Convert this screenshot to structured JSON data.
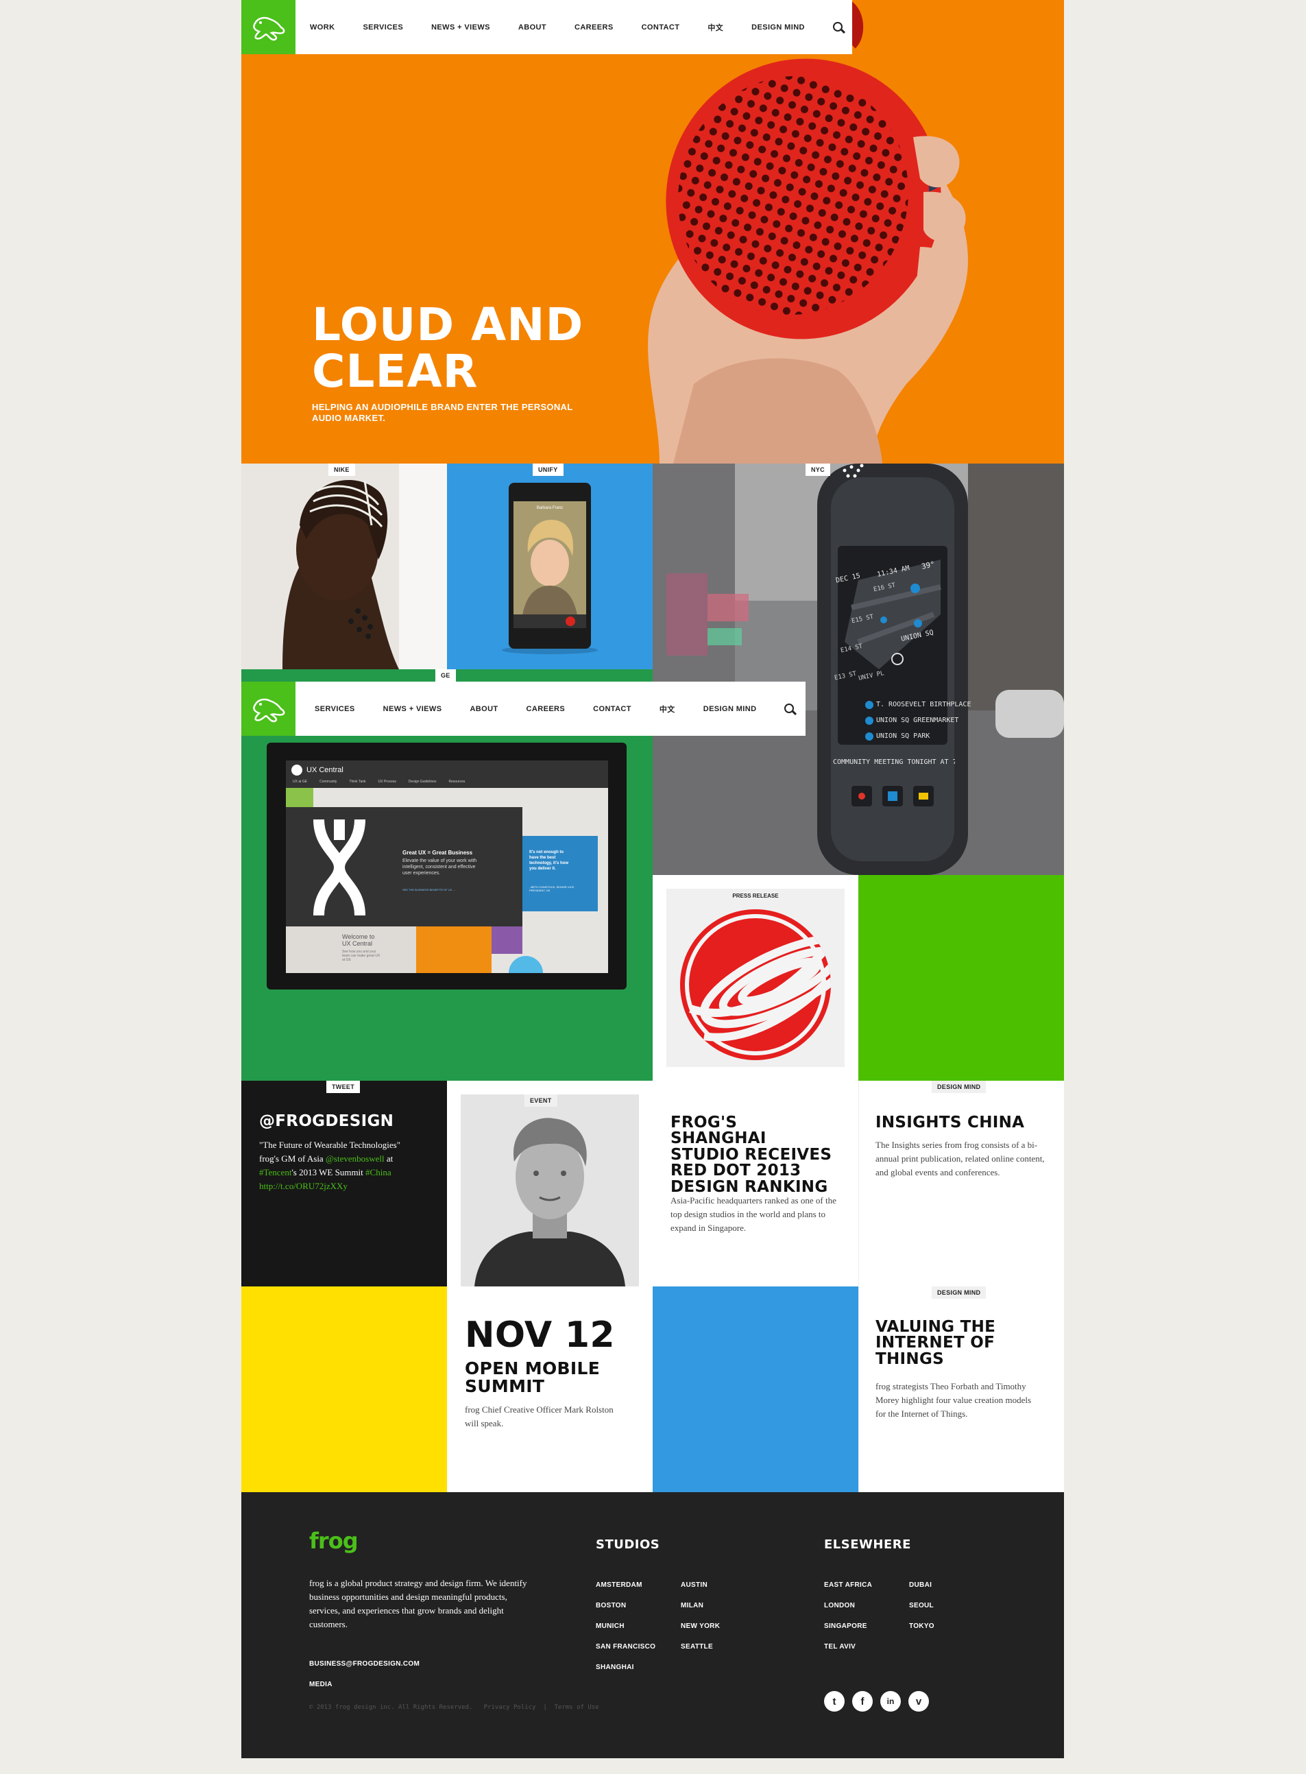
{
  "nav": {
    "items": [
      "WORK",
      "SERVICES",
      "NEWS + VIEWS",
      "ABOUT",
      "CAREERS",
      "CONTACT",
      "中文",
      "DESIGN MIND"
    ],
    "search_icon": "search-icon"
  },
  "nav2": {
    "items": [
      "SERVICES",
      "NEWS + VIEWS",
      "ABOUT",
      "CAREERS",
      "CONTACT",
      "中文",
      "DESIGN MIND"
    ]
  },
  "hero": {
    "title_line1": "LOUD AND",
    "title_line2": "CLEAR",
    "subtitle_line1": "HELPING AN AUDIOPHILE BRAND ENTER THE PERSONAL",
    "subtitle_line2": "AUDIO MARKET."
  },
  "tags": {
    "nike": "NIKE",
    "unify": "UNIFY",
    "nyc": "NYC",
    "ge": "GE",
    "press": "PRESS RELEASE",
    "tweet": "TWEET",
    "event": "EVENT",
    "designmind1": "DESIGN MIND",
    "designmind2": "DESIGN MIND"
  },
  "unify_phone": {
    "caller": "Barbara Franz"
  },
  "nyc_kiosk": {
    "date": "DEC 15",
    "time": "11:34 AM",
    "temp": "39°",
    "streets": [
      "E16 ST",
      "E15 ST",
      "E14 ST",
      "E13 ST",
      "UNION SQ",
      "UNIV PL"
    ],
    "pois": [
      "T. ROOSEVELT BIRTHPLACE",
      "UNION SQ GREENMARKET",
      "UNION SQ PARK"
    ],
    "ticker": "COMMUNITY MEETING TONIGHT AT 7:"
  },
  "ge_screen": {
    "app_title": "UX Central",
    "menu": [
      "UX at GE",
      "Community",
      "Think Tank",
      "UX Process",
      "Design Guidelines",
      "Resources"
    ],
    "headline": "Great UX = Great Business",
    "body": "Elevate the value of your work with intelligent, consistent and effective user experiences.",
    "link": "SEE THE BUSINESS BENEFITS OF UX →",
    "quote": "It's not enough to have the best technology, it's how you deliver it.",
    "quote_by": "- BETH COMSTOCK, SENIOR VICE PRESIDENT, GE",
    "welcome": "Welcome to UX Central",
    "welcome_body": "See how you and your team can make great UX at GE"
  },
  "tweet": {
    "handle": "@FROGDESIGN",
    "line1": "\"The Future of Wearable Technologies\"",
    "line2_a": "frog's GM of Asia ",
    "line2_mention": "@stevenboswell",
    "line2_b": " at",
    "line3_hashtag1": "#Tencent",
    "line3_b": "'s 2013 WE Summit ",
    "line3_hashtag2": "#China",
    "line4_link": "http://t.co/ORU72jzXXy"
  },
  "news_shanghai": {
    "title": "FROG'S SHANGHAI STUDIO RECEIVES RED DOT 2013 DESIGN RANKING",
    "body": "Asia-Pacific headquarters ranked as one of the top design studios in the world and plans to expand in Singapore."
  },
  "insights": {
    "title": "INSIGHTS CHINA",
    "body": "The Insights series from frog consists of a bi-annual print publication, related online content, and global events and conferences."
  },
  "event": {
    "date": "NOV 12",
    "title": "OPEN MOBILE SUMMIT",
    "body": "frog Chief Creative Officer Mark Rolston will speak."
  },
  "iot": {
    "title": "VALUING THE INTERNET OF THINGS",
    "body": "frog strategists Theo Forbath and Timothy Morey highlight four value creation models for the Internet of Things."
  },
  "footer": {
    "logo": "frog",
    "about": "frog is a global product strategy and design firm. We identify business opportunities and design meaningful products, services, and experiences that grow brands and delight customers.",
    "email": "BUSINESS@FROGDESIGN.COM",
    "media": "MEDIA",
    "copyright": "© 2013 frog design inc. All Rights Reserved.   Privacy Policy  |  Terms of Use",
    "studios_title": "STUDIOS",
    "studios_col1": [
      "AMSTERDAM",
      "BOSTON",
      "MUNICH",
      "SAN FRANCISCO",
      "SHANGHAI"
    ],
    "studios_col2": [
      "AUSTIN",
      "MILAN",
      "NEW YORK",
      "SEATTLE"
    ],
    "elsewhere_title": "ELSEWHERE",
    "elsewhere_col1": [
      "EAST AFRICA",
      "LONDON",
      "SINGAPORE",
      "TEL AVIV"
    ],
    "elsewhere_col2": [
      "DUBAI",
      "SEOUL",
      "TOKYO"
    ],
    "social": [
      {
        "name": "twitter-icon",
        "glyph": "t"
      },
      {
        "name": "facebook-icon",
        "glyph": "f"
      },
      {
        "name": "linkedin-icon",
        "glyph": "in"
      },
      {
        "name": "vimeo-icon",
        "glyph": "v"
      }
    ]
  },
  "colors": {
    "orange": "#f48300",
    "green": "#4bbf1a",
    "ge_green": "#239a4a",
    "blue": "#3399e0",
    "yellow": "#ffe000",
    "dark": "#222222",
    "tweet_bg": "#171717"
  }
}
